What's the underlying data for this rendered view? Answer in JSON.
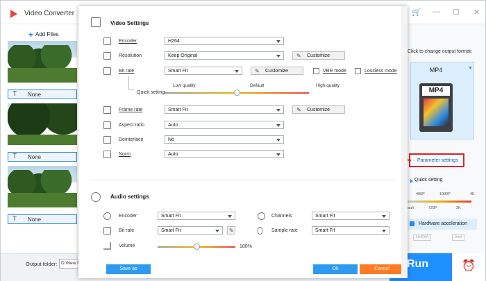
{
  "app": {
    "title": "Video Converter",
    "add_files": "Add Files",
    "output_folder_label": "Output folder:",
    "output_folder_value": "D:\\New f",
    "run_label": "Run",
    "window_controls": [
      "cart-icon",
      "minimize-icon",
      "maximize-icon",
      "close-icon"
    ]
  },
  "files": [
    {
      "subtitle": "None"
    },
    {
      "subtitle": "None"
    },
    {
      "subtitle": "None"
    }
  ],
  "right_panel": {
    "hint": "Click to change output format:",
    "format": "MP4",
    "format_label": "MP4",
    "parameter_settings": "Parameter settings",
    "quick_setting": "Quick setting",
    "ticks_top": [
      "480P",
      "1080P",
      "4K"
    ],
    "ticks_bottom": [
      "ault",
      "720P",
      "2K"
    ],
    "hw_accel": "Hardware acceleration",
    "gpu": [
      "NVIDIA",
      "Intel"
    ]
  },
  "dialog": {
    "video_title": "Video Settings",
    "encoder_label": "Encoder",
    "encoder_value": "H264",
    "resolution_label": "Resolution",
    "resolution_value": "Keep Original",
    "resolution_customize": "Customize",
    "bitrate_label": "Bit rate",
    "bitrate_value": "Smart Fit",
    "bitrate_customize": "Customize",
    "vbr_label": "VBR mode",
    "lossless_label": "Lossless mode",
    "quick_setting_label": "Quick setting",
    "quality_low": "Low quality",
    "quality_default": "Default",
    "quality_high": "High quality",
    "quality_slider": 0.5,
    "framerate_label": "Frame rate",
    "framerate_value": "Smart Fit",
    "framerate_customize": "Customize",
    "aspect_label": "Aspect ratio",
    "aspect_value": "Auto",
    "deinterlace_label": "Deinterlace",
    "deinterlace_value": "No",
    "norm_label": "Norm",
    "norm_value": "Auto",
    "audio_title": "Audio settings",
    "a_encoder_label": "Encoder",
    "a_encoder_value": "Smart Fit",
    "channels_label": "Channels",
    "channels_value": "Smart Fit",
    "a_bitrate_label": "Bit rate",
    "a_bitrate_value": "Smart Fit",
    "samplerate_label": "Sample rate",
    "samplerate_value": "Smart Fit",
    "volume_label": "Volume",
    "volume_value": "100%",
    "volume_slider": 0.5,
    "save_as": "Save as",
    "ok": "Ok",
    "cancel": "Cancel"
  },
  "colors": {
    "accent": "#2e9af0",
    "cancel": "#ff7a22",
    "highlight": "#d8232a"
  }
}
